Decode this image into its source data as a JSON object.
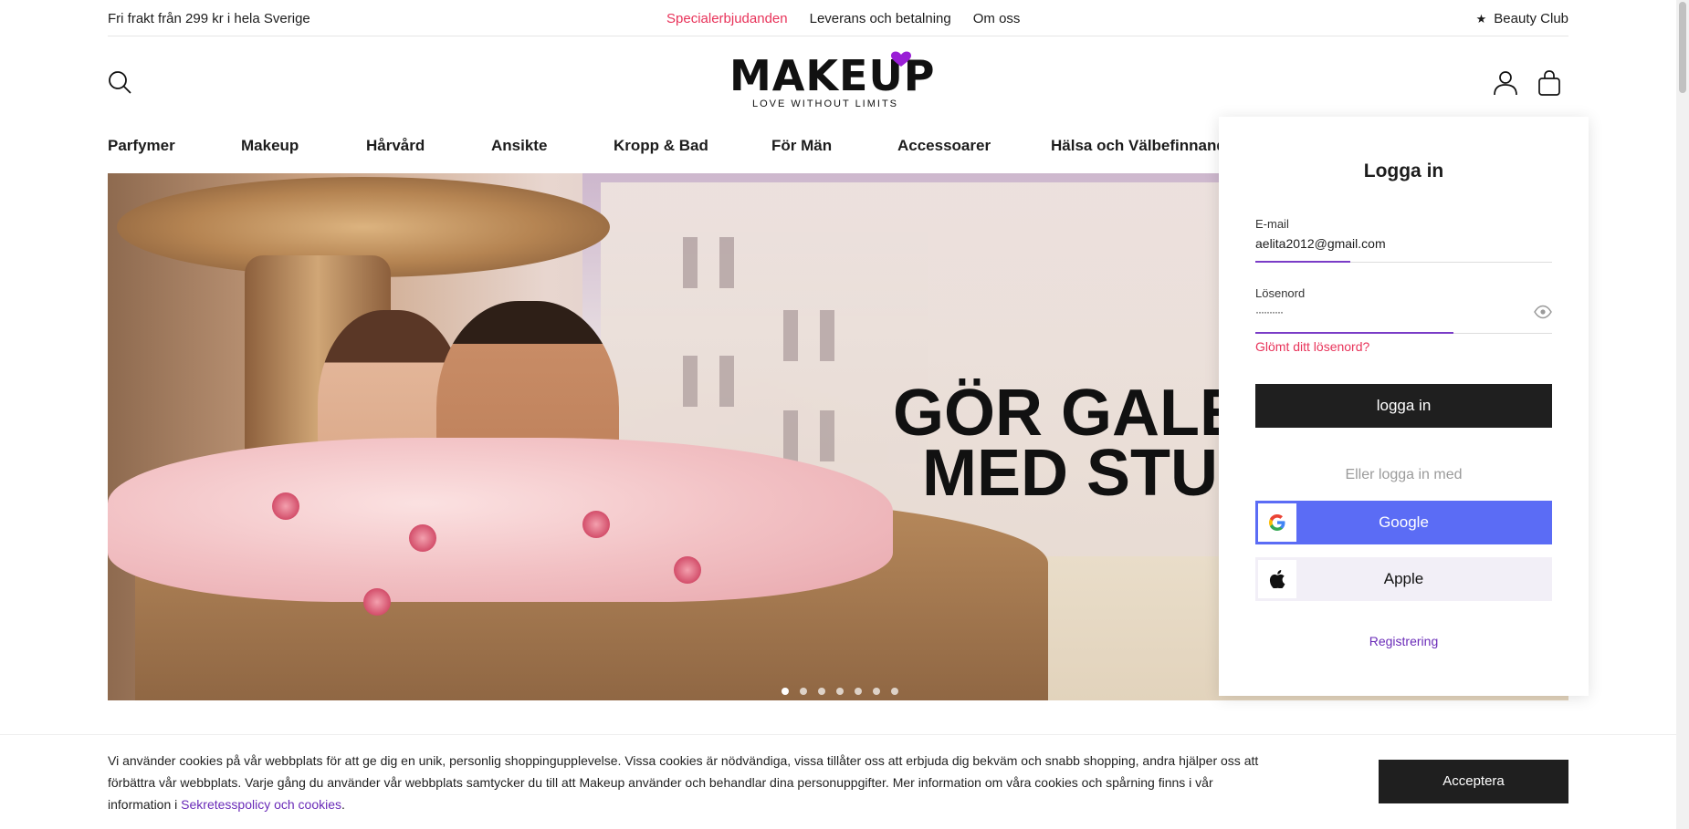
{
  "topbar": {
    "shipping_notice": "Fri frakt från 299 kr i hela Sverige",
    "links": [
      "Specialerbjudanden",
      "Leverans och betalning",
      "Om oss"
    ],
    "club_icon": "star-icon",
    "club_label": "Beauty Club"
  },
  "header": {
    "logo_text": "MAKEUP",
    "logo_tagline": "LOVE WITHOUT LIMITS",
    "icons": [
      "search-icon",
      "account-icon",
      "bag-icon"
    ]
  },
  "nav": {
    "items": [
      "Parfymer",
      "Makeup",
      "Hårvård",
      "Ansikte",
      "Kropp & Bad",
      "För Män",
      "Accessoarer",
      "Hälsa och Välbefinnande"
    ]
  },
  "banner": {
    "headline_line1": "GÖR GALEN",
    "headline_line2": "MED STUP",
    "slide_count": 7,
    "active_slide": 1
  },
  "login": {
    "title": "Logga in",
    "email_label": "E-mail",
    "email_value": "aelita2012@gmail.com",
    "password_label": "Lösenord",
    "password_value": "··········",
    "forgot_link": "Glömt ditt lösenord?",
    "submit_label": "logga in",
    "or_text": "Eller logga in med",
    "google_label": "Google",
    "apple_label": "Apple",
    "register_link": "Registrering"
  },
  "cookie": {
    "text": "Vi använder cookies på vår webbplats för att ge dig en unik, personlig shoppingupplevelse. Vissa cookies är nödvändiga, vissa tillåter oss att erbjuda dig bekväm och snabb shopping, andra hjälper oss att förbättra vår webbplats. Varje gång du använder vår webbplats samtycker du till att Makeup använder och behandlar dina personuppgifter. Mer information om våra cookies och spårning finns i vår information i ",
    "link": "Sekretesspolicy och cookies",
    "after_link": ".",
    "accept_label": "Acceptera"
  },
  "colors": {
    "promo": "#e8335a",
    "accent_purple": "#6a2bb8",
    "google_blue": "#5b6cf5",
    "dark_button": "#1f1f1f"
  }
}
